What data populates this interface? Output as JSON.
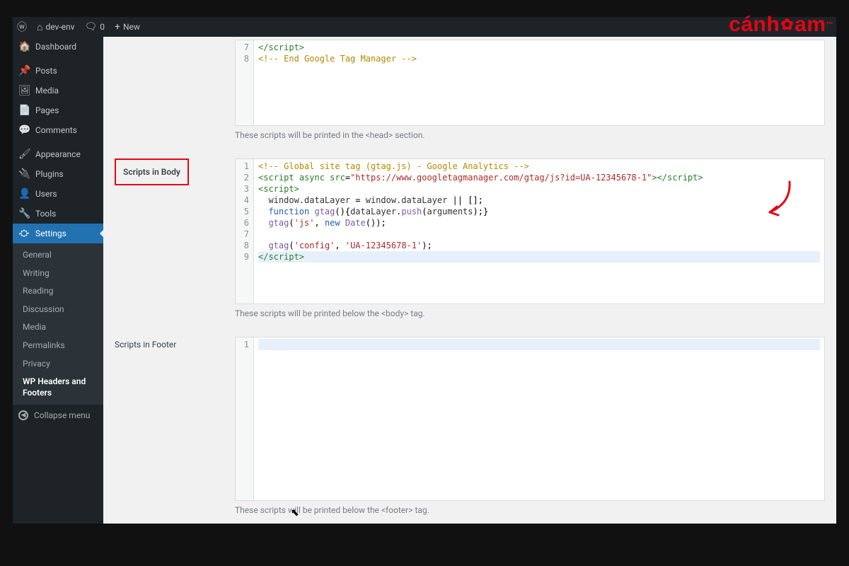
{
  "topbar": {
    "site_name": "dev-env",
    "comments_count": "0",
    "new_label": "New"
  },
  "sidebar": {
    "items": [
      {
        "label": "Dashboard",
        "icon": "▤"
      },
      {
        "label": "Posts",
        "icon": "✎"
      },
      {
        "label": "Media",
        "icon": "✿"
      },
      {
        "label": "Pages",
        "icon": "▥"
      },
      {
        "label": "Comments",
        "icon": "💬"
      },
      {
        "label": "Appearance",
        "icon": "✦"
      },
      {
        "label": "Plugins",
        "icon": "⚙"
      },
      {
        "label": "Users",
        "icon": "👤"
      },
      {
        "label": "Tools",
        "icon": "✔"
      },
      {
        "label": "Settings",
        "icon": "⛶"
      }
    ],
    "submenu": [
      "General",
      "Writing",
      "Reading",
      "Discussion",
      "Media",
      "Permalinks",
      "Privacy",
      "WP Headers and Footers"
    ],
    "collapse": "Collapse menu"
  },
  "sections": {
    "head": {
      "help": "These scripts will be printed in the <head> section.",
      "lines": [
        {
          "n": 7,
          "html": "<span class='t-tag'>&lt;/script&gt;</span>"
        },
        {
          "n": 8,
          "html": "<span class='t-com'>&lt;!-- End Google Tag Manager --&gt;</span>"
        }
      ]
    },
    "body": {
      "label": "Scripts in Body",
      "help": "These scripts will be printed below the <body> tag.",
      "lines": [
        {
          "n": 1,
          "html": "<span class='t-com'>&lt;!-- Global site tag (gtag.js) - Google Analytics --&gt;</span>"
        },
        {
          "n": 2,
          "html": "<span class='t-tag'>&lt;script</span> <span class='t-attr'>async src</span>=<span class='t-str'>\"https://www.googletagmanager.com/gtag/js?id=UA-12345678-1\"</span><span class='t-tag'>&gt;&lt;/script&gt;</span>"
        },
        {
          "n": 3,
          "html": "<span class='t-tag'>&lt;script&gt;</span>"
        },
        {
          "n": 4,
          "html": "  <span class='t-var'>window.dataLayer</span> = <span class='t-var'>window.dataLayer</span> || [];"
        },
        {
          "n": 5,
          "html": "  <span class='t-kw'>function</span> <span class='t-func'>gtag</span>(){<span class='t-var'>dataLayer</span>.<span class='t-func'>push</span>(<span class='t-var'>arguments</span>);}"
        },
        {
          "n": 6,
          "html": "  <span class='t-func'>gtag</span>(<span class='t-str'>'js'</span>, <span class='t-kw'>new</span> <span class='t-func'>Date</span>());"
        },
        {
          "n": 7,
          "html": ""
        },
        {
          "n": 8,
          "html": "  <span class='t-func'>gtag</span>(<span class='t-str'>'config'</span>, <span class='t-str'>'UA-12345678-1'</span>);"
        },
        {
          "n": 9,
          "html": "<span class='t-tag'>&lt;/script&gt;</span>",
          "hl": true
        }
      ]
    },
    "footer": {
      "label": "Scripts in Footer",
      "help": "These scripts will be printed below the <footer> tag.",
      "lines": [
        {
          "n": 1,
          "html": "",
          "hl": true
        }
      ]
    }
  },
  "brand": "cánh🟊am"
}
